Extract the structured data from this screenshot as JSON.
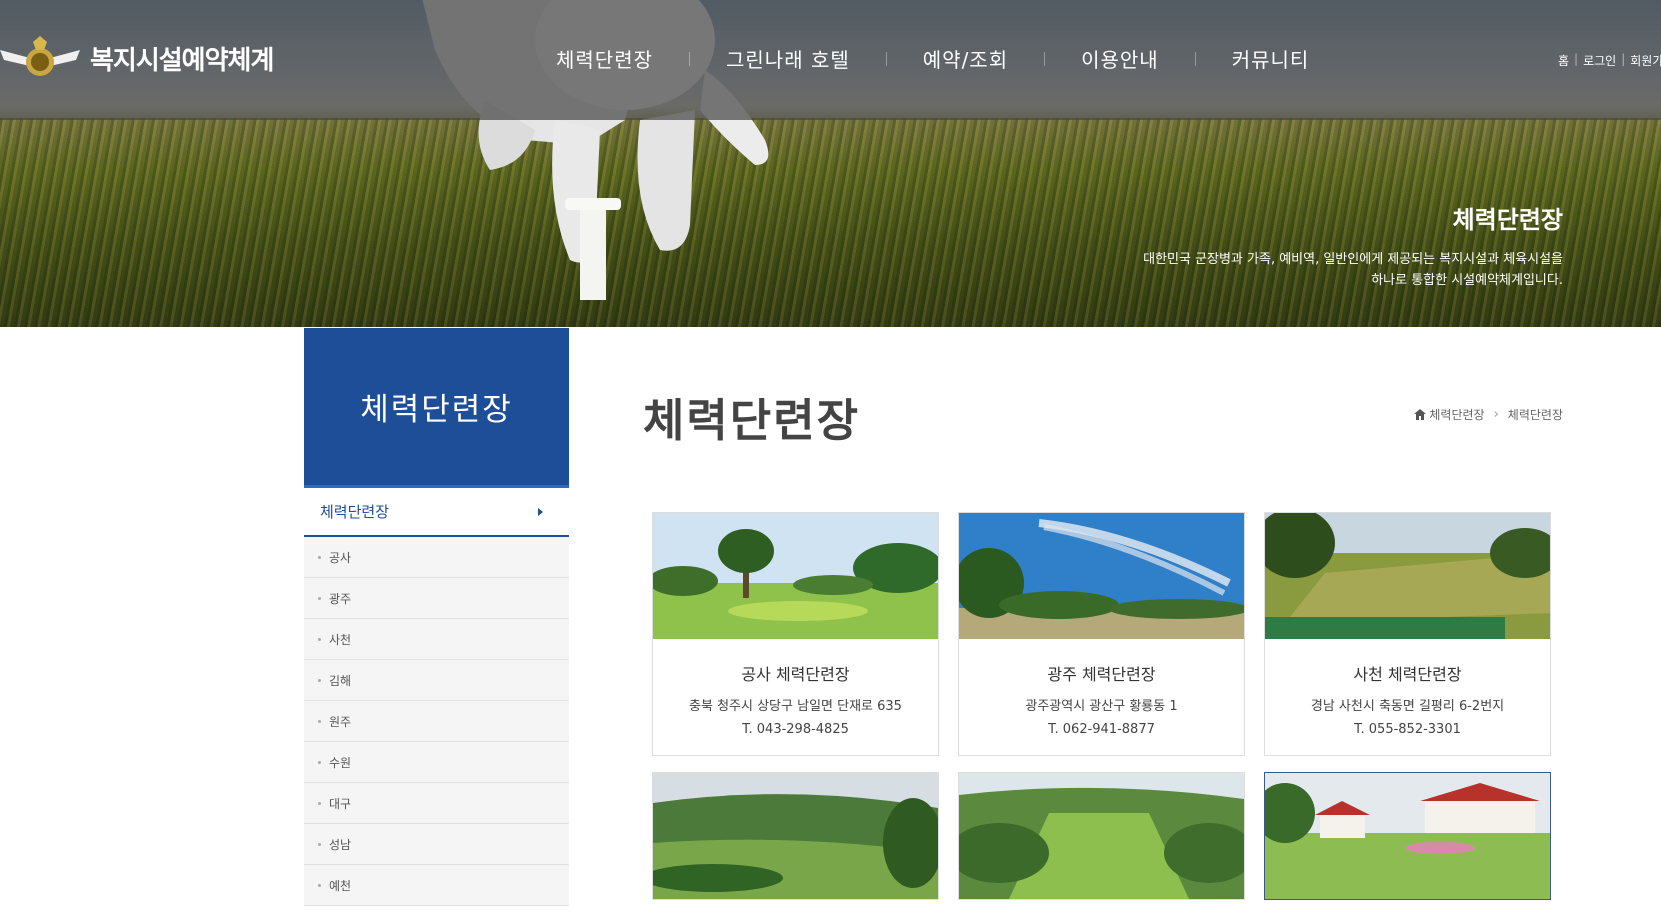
{
  "header": {
    "brand": "복지시설예약체계",
    "nav": [
      "체력단련장",
      "그린나래 호텔",
      "예약/조회",
      "이용안내",
      "커뮤니티"
    ],
    "util": [
      "홈",
      "로그인",
      "회원가"
    ]
  },
  "hero": {
    "title": "체력단련장",
    "desc_line1": "대한민국 군장병과 가족, 예비역, 일반인에게 제공되는 복지시설과 체육시설을",
    "desc_line2": "하나로 통합한 시설예약체계입니다."
  },
  "sidebar": {
    "title": "체력단련장",
    "active": "체력단련장",
    "items": [
      "공사",
      "광주",
      "사천",
      "김해",
      "원주",
      "수원",
      "대구",
      "성남",
      "예천"
    ]
  },
  "main": {
    "title": "체력단련장",
    "breadcrumb": [
      "체력단련장",
      "체력단련장"
    ]
  },
  "cards": [
    {
      "name": "공사 체력단련장",
      "addr": "충북 청주시 상당구 남일면 단재로 635",
      "tel": "T. 043-298-4825"
    },
    {
      "name": "광주 체력단련장",
      "addr": "광주광역시 광산구 황룡동 1",
      "tel": "T. 062-941-8877"
    },
    {
      "name": "사천 체력단련장",
      "addr": "경남 사천시 축동면 길평리 6-2번지",
      "tel": "T. 055-852-3301"
    },
    {
      "name": "",
      "addr": "",
      "tel": ""
    },
    {
      "name": "",
      "addr": "",
      "tel": ""
    },
    {
      "name": "",
      "addr": "",
      "tel": ""
    }
  ]
}
